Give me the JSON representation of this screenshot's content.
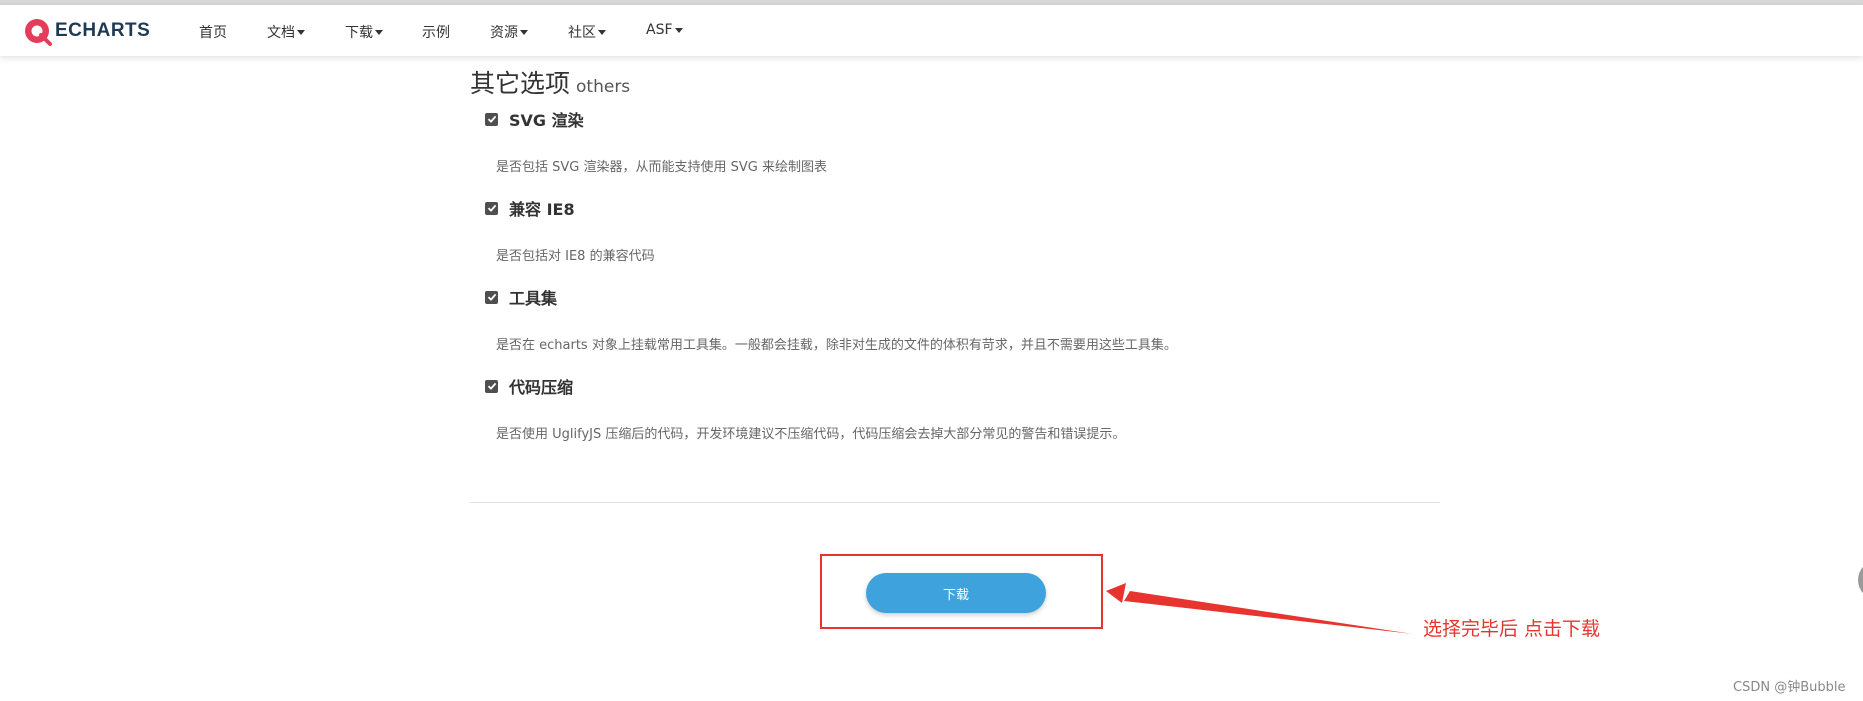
{
  "nav": {
    "logo_text": "ECHARTS",
    "items": [
      {
        "label": "首页",
        "dropdown": false
      },
      {
        "label": "文档",
        "dropdown": true
      },
      {
        "label": "下载",
        "dropdown": true
      },
      {
        "label": "示例",
        "dropdown": false
      },
      {
        "label": "资源",
        "dropdown": true
      },
      {
        "label": "社区",
        "dropdown": true
      },
      {
        "label": "ASF",
        "dropdown": true
      }
    ]
  },
  "section": {
    "title": "其它选项",
    "subtitle": "others"
  },
  "options": [
    {
      "label": "SVG 渲染",
      "checked": true,
      "description": "是否包括 SVG 渲染器，从而能支持使用 SVG 来绘制图表"
    },
    {
      "label": "兼容 IE8",
      "checked": true,
      "description": "是否包括对 IE8 的兼容代码"
    },
    {
      "label": "工具集",
      "checked": true,
      "description": "是否在 echarts 对象上挂载常用工具集。一般都会挂载，除非对生成的文件的体积有苛求，并且不需要用这些工具集。"
    },
    {
      "label": "代码压缩",
      "checked": true,
      "description": "是否使用 UglifyJS 压缩后的代码，开发环境建议不压缩代码，代码压缩会去掉大部分常见的警告和错误提示。"
    }
  ],
  "download_button": "下载",
  "annotation": "选择完毕后 点击下载",
  "watermark": "CSDN @钟Bubble",
  "colors": {
    "brand_red": "#e43c59",
    "logo_navy": "#1f3a55",
    "button_blue": "#3ea2dc",
    "annotation_red": "#e8342f"
  },
  "icons": {
    "logo": "echarts-logo-icon",
    "checkbox": "checkbox-checked-icon",
    "caret": "caret-down-icon"
  }
}
